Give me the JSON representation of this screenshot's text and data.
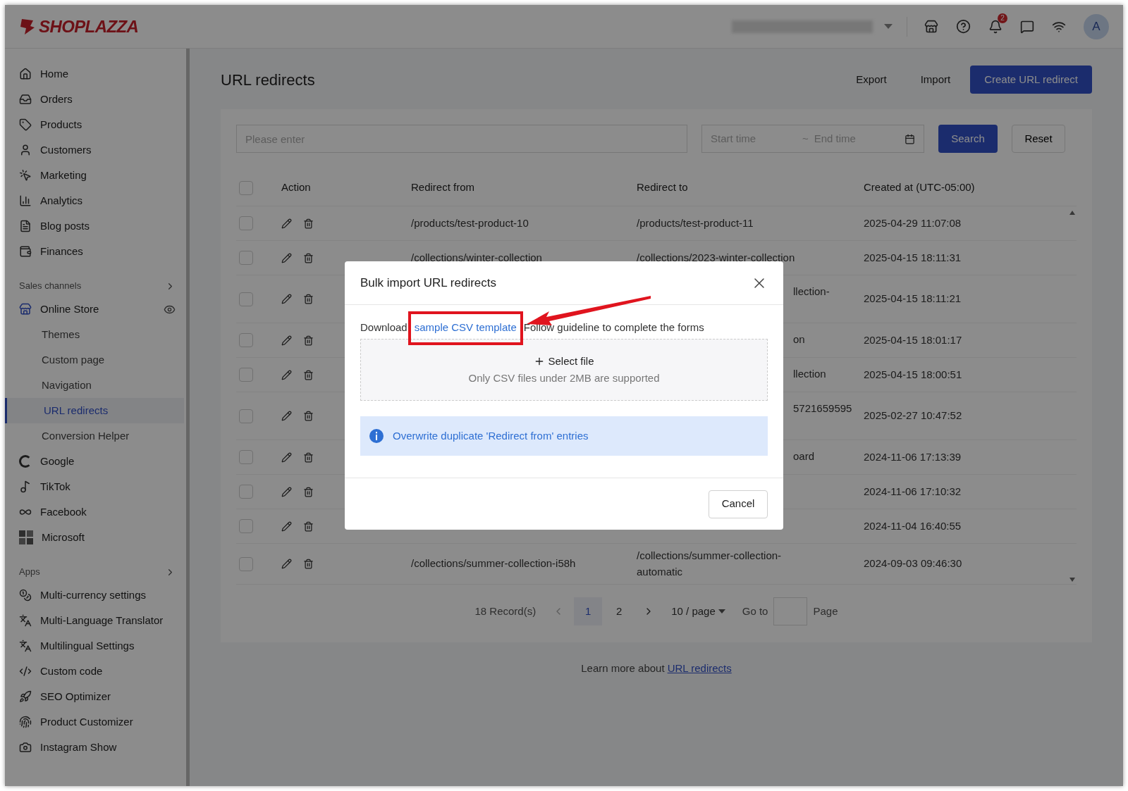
{
  "logo": {
    "text": "SHOPLAZZA"
  },
  "topbar": {
    "notification_count": "2",
    "avatar": "A"
  },
  "sidebar": {
    "items": [
      {
        "label": "Home",
        "selected": false
      },
      {
        "label": "Orders",
        "selected": false
      },
      {
        "label": "Products",
        "selected": false
      },
      {
        "label": "Customers",
        "selected": false
      },
      {
        "label": "Marketing",
        "selected": false
      },
      {
        "label": "Analytics",
        "selected": false
      },
      {
        "label": "Blog posts",
        "selected": false
      },
      {
        "label": "Finances",
        "selected": false
      }
    ],
    "sales_channels": {
      "title": "Sales channels",
      "store": {
        "label": "Online Store",
        "children": [
          {
            "label": "Themes",
            "selected": false
          },
          {
            "label": "Custom page",
            "selected": false
          },
          {
            "label": "Navigation",
            "selected": false
          },
          {
            "label": "URL redirects",
            "selected": true
          },
          {
            "label": "Conversion Helper",
            "selected": false
          }
        ]
      },
      "channels": [
        {
          "label": "Google"
        },
        {
          "label": "TikTok"
        },
        {
          "label": "Facebook"
        },
        {
          "label": "Microsoft"
        }
      ]
    },
    "apps": {
      "title": "Apps",
      "items": [
        {
          "label": "Multi-currency settings"
        },
        {
          "label": "Multi-Language Translator"
        },
        {
          "label": "Multilingual Settings"
        },
        {
          "label": "Custom code"
        },
        {
          "label": "SEO Optimizer"
        },
        {
          "label": "Product Customizer"
        },
        {
          "label": "Instagram Show"
        }
      ]
    }
  },
  "page": {
    "title": "URL redirects",
    "actions": [
      "Export",
      "Import"
    ],
    "primary_action": "Create URL redirect"
  },
  "filters": {
    "search_placeholder": "Please enter",
    "start_placeholder": "Start time",
    "separator": "~",
    "end_placeholder": "End time",
    "search_button": "Search",
    "reset_button": "Reset"
  },
  "table": {
    "select_all_checked": false,
    "columns": [
      "Action",
      "Redirect from",
      "Redirect to",
      "Created at (UTC-05:00)"
    ],
    "rows": [
      {
        "kind": "full",
        "checked": false,
        "from": "/products/test-product-10",
        "to": "/products/test-product-11",
        "created": "2025-04-29 11:07:08"
      },
      {
        "kind": "full",
        "checked": false,
        "from": "/collections/winter-collection",
        "to": "/collections/2023-winter-collection",
        "created": "2025-04-15 18:11:31"
      },
      {
        "kind": "covered_tall",
        "checked": false,
        "to": "llection-",
        "created": "2025-04-15 18:11:21"
      },
      {
        "kind": "covered",
        "checked": false,
        "to": "on",
        "created": "2025-04-15 18:01:17"
      },
      {
        "kind": "covered",
        "checked": false,
        "to": "llection",
        "created": "2025-04-15 18:00:51"
      },
      {
        "kind": "covered_tall",
        "checked": false,
        "to": "5721659595",
        "created": "2025-02-27 10:47:52"
      },
      {
        "kind": "covered",
        "checked": false,
        "to": "oard",
        "created": "2024-11-06 17:13:39"
      },
      {
        "kind": "covered",
        "checked": false,
        "created": "2024-11-06 17:10:32"
      },
      {
        "kind": "covered",
        "checked": false,
        "created": "2024-11-04 16:40:55"
      },
      {
        "kind": "full",
        "checked": false,
        "from": "/collections/summer-collection-i58h",
        "to": "/collections/summer-collection-automatic",
        "created": "2024-09-03 09:46:30"
      }
    ]
  },
  "pagination": {
    "total": "18 Record(s)",
    "pages": [
      {
        "label": "1",
        "selected": true
      },
      {
        "label": "2",
        "selected": false
      }
    ],
    "page_size": "10 / page",
    "goto_label": "Go to",
    "page_label": "Page"
  },
  "footer": {
    "text": "Learn more about",
    "link": "URL redirects"
  },
  "modal": {
    "title": "Bulk import URL redirects",
    "prefix": "Download",
    "link": "sample CSV template",
    "suffix": "Follow guideline to complete the forms",
    "upload_label": "Select file",
    "upload_hint": "Only CSV files under 2MB are supported",
    "info": "Overwrite duplicate 'Redirect from' entries",
    "cancel": "Cancel"
  }
}
